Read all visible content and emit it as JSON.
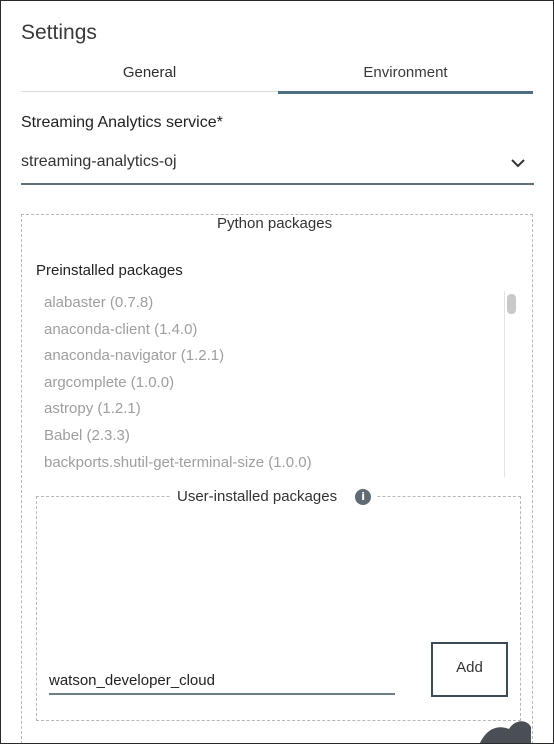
{
  "panel": {
    "title": "Settings"
  },
  "tabs": [
    {
      "label": "General",
      "active": false
    },
    {
      "label": "Environment",
      "active": true
    }
  ],
  "service": {
    "label": "Streaming Analytics service*",
    "selected_value": "streaming-analytics-oj",
    "icon": "chevron-down-icon"
  },
  "python_packages": {
    "legend": "Python packages",
    "preinstalled": {
      "label": "Preinstalled packages",
      "items": [
        "alabaster (0.7.8)",
        "anaconda-client (1.4.0)",
        "anaconda-navigator (1.2.1)",
        "argcomplete (1.0.0)",
        "astropy (1.2.1)",
        "Babel (2.3.3)",
        "backports.shutil-get-terminal-size (1.0.0)"
      ]
    },
    "user_installed": {
      "legend": "User-installed packages",
      "info_icon": "info-icon",
      "input_value": "watson_developer_cloud",
      "add_label": "Add"
    }
  },
  "colors": {
    "active_tab_underline": "#4d6f86",
    "muted_text": "#9e9e9e",
    "field_underline": "#5e6f7a",
    "button_border": "#3c4b57"
  }
}
